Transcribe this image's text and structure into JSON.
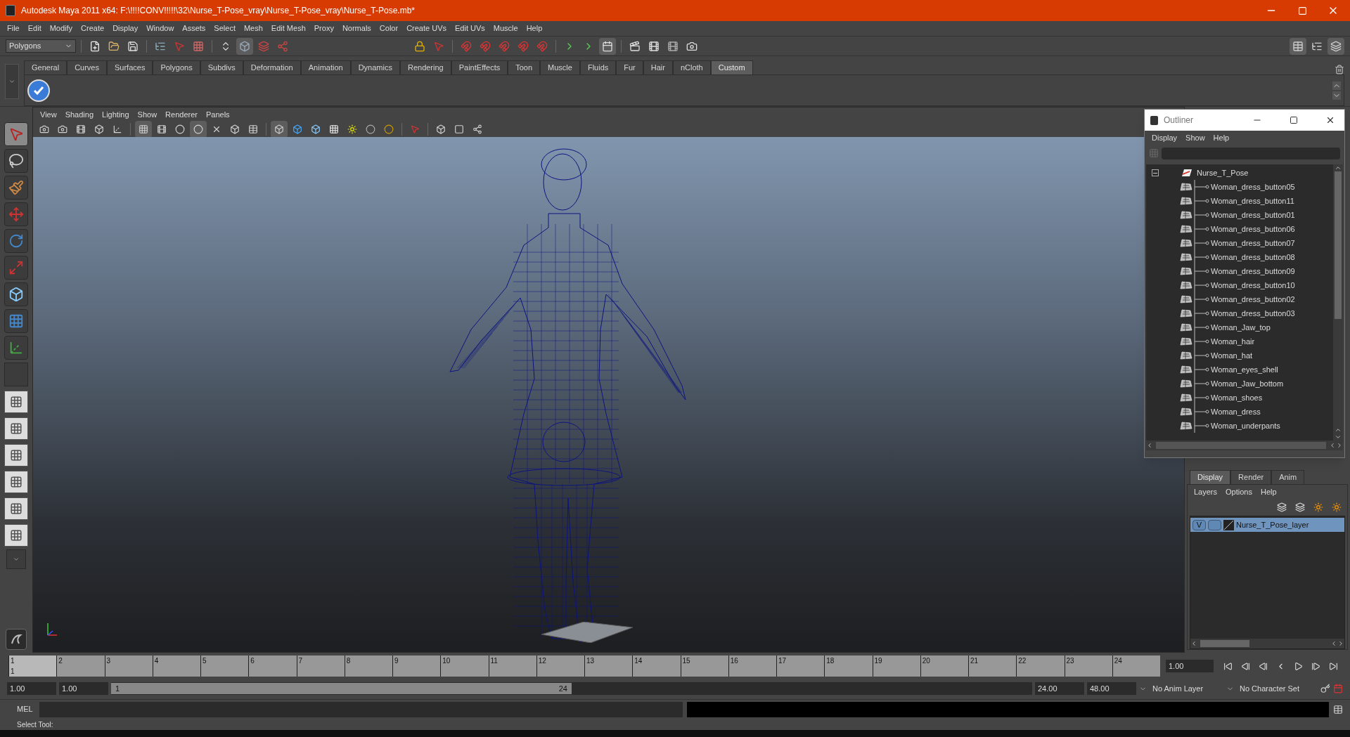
{
  "window": {
    "title": "Autodesk Maya 2011 x64: F:\\!!!!CONV!!!!!\\32\\Nurse_T-Pose_vray\\Nurse_T-Pose_vray\\Nurse_T-Pose.mb*"
  },
  "menu_bar": [
    "File",
    "Edit",
    "Modify",
    "Create",
    "Display",
    "Window",
    "Assets",
    "Select",
    "Mesh",
    "Edit Mesh",
    "Proxy",
    "Normals",
    "Color",
    "Create UVs",
    "Edit UVs",
    "Muscle",
    "Help"
  ],
  "status_line": {
    "menu_set": "Polygons"
  },
  "shelf": {
    "tabs": [
      {
        "label": "General",
        "selected": false
      },
      {
        "label": "Curves",
        "selected": false
      },
      {
        "label": "Surfaces",
        "selected": false
      },
      {
        "label": "Polygons",
        "selected": false
      },
      {
        "label": "Subdivs",
        "selected": false
      },
      {
        "label": "Deformation",
        "selected": false
      },
      {
        "label": "Animation",
        "selected": false
      },
      {
        "label": "Dynamics",
        "selected": false
      },
      {
        "label": "Rendering",
        "selected": false
      },
      {
        "label": "PaintEffects",
        "selected": false
      },
      {
        "label": "Toon",
        "selected": false
      },
      {
        "label": "Muscle",
        "selected": false
      },
      {
        "label": "Fluids",
        "selected": false
      },
      {
        "label": "Fur",
        "selected": false
      },
      {
        "label": "Hair",
        "selected": false
      },
      {
        "label": "nCloth",
        "selected": false
      },
      {
        "label": "Custom",
        "selected": true
      }
    ]
  },
  "panel_menu": [
    "View",
    "Shading",
    "Lighting",
    "Show",
    "Renderer",
    "Panels"
  ],
  "outliner": {
    "title": "Outliner",
    "menu": [
      "Display",
      "Show",
      "Help"
    ],
    "root": {
      "label": "Nurse_T_Pose",
      "expanded": true,
      "children": [
        {
          "label": "Woman_dress_button05"
        },
        {
          "label": "Woman_dress_button11"
        },
        {
          "label": "Woman_dress_button01"
        },
        {
          "label": "Woman_dress_button06"
        },
        {
          "label": "Woman_dress_button07"
        },
        {
          "label": "Woman_dress_button08"
        },
        {
          "label": "Woman_dress_button09"
        },
        {
          "label": "Woman_dress_button10"
        },
        {
          "label": "Woman_dress_button02"
        },
        {
          "label": "Woman_dress_button03"
        },
        {
          "label": "Woman_Jaw_top"
        },
        {
          "label": "Woman_hair"
        },
        {
          "label": "Woman_hat"
        },
        {
          "label": "Woman_eyes_shell"
        },
        {
          "label": "Woman_Jaw_bottom"
        },
        {
          "label": "Woman_shoes"
        },
        {
          "label": "Woman_dress"
        },
        {
          "label": "Woman_underpants"
        }
      ]
    }
  },
  "layer_editor": {
    "tabs": [
      {
        "label": "Display",
        "selected": true
      },
      {
        "label": "Render",
        "selected": false
      },
      {
        "label": "Anim",
        "selected": false
      }
    ],
    "menu": [
      "Layers",
      "Options",
      "Help"
    ],
    "layers": [
      {
        "name": "Nurse_T_Pose_layer",
        "visible_label": "V",
        "selected": true
      }
    ]
  },
  "time_slider": {
    "ticks": [
      {
        "label": "1",
        "selected": true
      },
      {
        "label": "2",
        "selected": false
      },
      {
        "label": "3",
        "selected": false
      },
      {
        "label": "4",
        "selected": false
      },
      {
        "label": "5",
        "selected": false
      },
      {
        "label": "6",
        "selected": false
      },
      {
        "label": "7",
        "selected": false
      },
      {
        "label": "8",
        "selected": false
      },
      {
        "label": "9",
        "selected": false
      },
      {
        "label": "10",
        "selected": false
      },
      {
        "label": "11",
        "selected": false
      },
      {
        "label": "12",
        "selected": false
      },
      {
        "label": "13",
        "selected": false
      },
      {
        "label": "14",
        "selected": false
      },
      {
        "label": "15",
        "selected": false
      },
      {
        "label": "16",
        "selected": false
      },
      {
        "label": "17",
        "selected": false
      },
      {
        "label": "18",
        "selected": false
      },
      {
        "label": "19",
        "selected": false
      },
      {
        "label": "20",
        "selected": false
      },
      {
        "label": "21",
        "selected": false
      },
      {
        "label": "22",
        "selected": false
      },
      {
        "label": "23",
        "selected": false
      },
      {
        "label": "24",
        "selected": false
      }
    ],
    "current_frame": "1",
    "current_time": "1.00"
  },
  "range_slider": {
    "start": "1.00",
    "playback_start": "1.00",
    "range_start": "1",
    "range_end": "24",
    "playback_end": "24.00",
    "end": "48.00",
    "anim_layer": "No Anim Layer",
    "character_set": "No Character Set"
  },
  "command_line": {
    "label": "MEL"
  },
  "help_line": "Select Tool:"
}
